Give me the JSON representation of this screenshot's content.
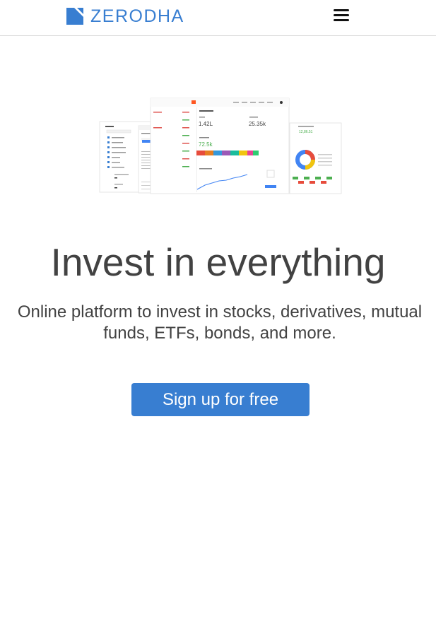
{
  "brand": {
    "name": "ZERODHA",
    "color": "#387ed1",
    "logo_icon": "zerodha-logo-icon"
  },
  "nav": {
    "menu_icon": "hamburger-menu-icon"
  },
  "hero": {
    "image_icon": "platform-dashboard-screenshot",
    "headline": "Invest in everything",
    "subheadline": "Online platform to invest in stocks, derivatives, mutual funds, ETFs, bonds, and more.",
    "cta_label": "Sign up for free",
    "cta_color": "#387ed1"
  }
}
